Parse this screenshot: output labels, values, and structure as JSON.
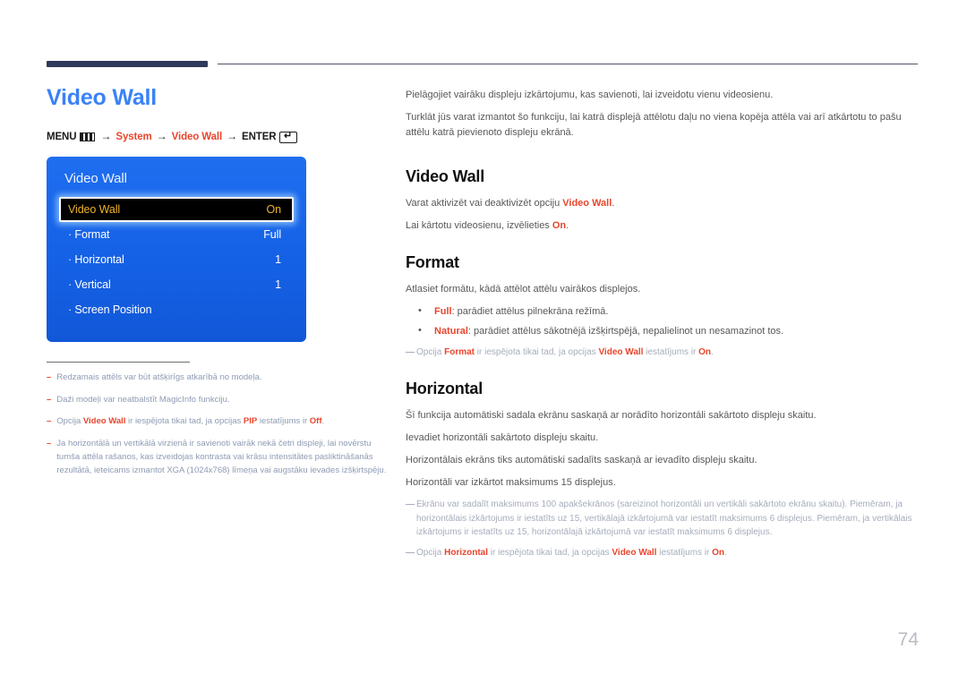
{
  "page": {
    "number": "74"
  },
  "left": {
    "title": "Video Wall",
    "breadcrumb": {
      "menu_label": "MENU",
      "menu_icon": "menu-bars-icon",
      "arrow": "→",
      "item1": "System",
      "item2": "Video Wall",
      "enter_label": "ENTER",
      "enter_icon": "enter-key-icon",
      "enter_glyph": "↵"
    },
    "osd": {
      "title": "Video Wall",
      "rows": [
        {
          "label": "Video Wall",
          "value": "On",
          "selected": true
        },
        {
          "label": "· Format",
          "value": "Full",
          "selected": false
        },
        {
          "label": "· Horizontal",
          "value": "1",
          "selected": false
        },
        {
          "label": "· Vertical",
          "value": "1",
          "selected": false
        },
        {
          "label": "· Screen Position",
          "value": "",
          "selected": false
        }
      ]
    },
    "notes": [
      {
        "dash": "–",
        "html": "Redzamais attēls var būt atšķirīgs atkarībā no modeļa."
      },
      {
        "dash": "–",
        "html": "Daži modeļi var neatbalstīt MagicInfo funkciju."
      },
      {
        "dash": "–",
        "html": "Opcija <b>Video Wall</b> ir iespējota tikai tad, ja opcijas <b>PIP</b> iestatījums ir <b>Off</b>."
      },
      {
        "dash": "–",
        "html": "Ja horizontālā un vertikālā virzienā ir savienoti vairāk nekā četri displeji, lai novērstu tumša attēla rašanos, kas izveidojas kontrasta vai krāsu intensitātes pasliktināšanās rezultātā, ieteicams izmantot XGA (1024x768) līmeņa vai augstāku ievades izšķirtspēju."
      }
    ]
  },
  "right": {
    "intro": [
      "Pielāgojiet vairāku displeju izkārtojumu, kas savienoti, lai izveidotu vienu videosienu.",
      "Turklāt jūs varat izmantot šo funkciju, lai katrā displejā attēlotu daļu no viena kopēja attēla vai arī atkārtotu to pašu attēlu katrā pievienoto displeju ekrānā."
    ],
    "sections": [
      {
        "heading": "Video Wall",
        "paragraphs": [
          "Varat aktivizēt vai deaktivizēt opciju <b>Video Wall</b>.",
          "Lai kārtotu videosienu, izvēlieties <b>On</b>."
        ],
        "bullets": [],
        "notes": []
      },
      {
        "heading": "Format",
        "paragraphs": [
          "Atlasiet formātu, kādā attēlot attēlu vairākos displejos."
        ],
        "bullets": [
          "<b>Full</b>: parādiet attēlus pilnekrāna režīmā.",
          "<b>Natural</b>: parādiet attēlus sākotnējā izšķirtspējā, nepalielinot un nesamazinot tos."
        ],
        "notes": [
          "Opcija <b>Format</b> ir iespējota tikai tad, ja opcijas <b>Video Wall</b> iestatījums ir <b>On</b>."
        ]
      },
      {
        "heading": "Horizontal",
        "paragraphs": [
          "Šī funkcija automātiski sadala ekrānu saskaņā ar norādīto horizontāli sakārtoto displeju skaitu.",
          "Ievadiet horizontāli sakārtoto displeju skaitu.",
          "Horizontālais ekrāns tiks automātiski sadalīts saskaņā ar ievadīto displeju skaitu.",
          "Horizontāli var izkārtot maksimums 15 displejus."
        ],
        "bullets": [],
        "notes": [
          "Ekrānu var sadalīt maksimums 100 apakšekrānos (sareizinot horizontāli un vertikāli sakārtoto ekrānu skaitu). Piemēram, ja horizontālais izkārtojums ir iestatīts uz 15, vertikālajā izkārtojumā var iestatīt maksimums 6 displejus. Piemēram, ja vertikālais izkārtojums ir iestatīts uz 15, horizontālajā izkārtojumā var iestatīt maksimums 6 displejus.",
          "Opcija <b>Horizontal</b> ir iespējota tikai tad, ja opcijas <b>Video Wall</b> iestatījums ir <b>On</b>."
        ]
      }
    ]
  },
  "colors": {
    "accent_blue": "#3b82f6",
    "osd_blue": "#1564e8",
    "accent_red": "#e8452c",
    "header_navy": "#2e3a59",
    "osd_highlight_text": "#f0b429"
  }
}
